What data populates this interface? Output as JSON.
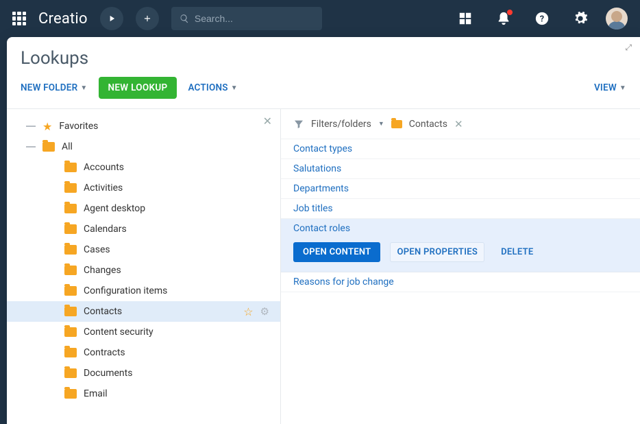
{
  "header": {
    "logo": "Creatio",
    "search_placeholder": "Search..."
  },
  "page": {
    "title": "Lookups"
  },
  "toolbar": {
    "new_folder": "NEW FOLDER",
    "new_lookup": "NEW LOOKUP",
    "actions": "ACTIONS",
    "view": "VIEW"
  },
  "sidebar": {
    "favorites": "Favorites",
    "all": "All",
    "folders": [
      "Accounts",
      "Activities",
      "Agent desktop",
      "Calendars",
      "Cases",
      "Changes",
      "Configuration items",
      "Contacts",
      "Content security",
      "Contracts",
      "Documents",
      "Email"
    ],
    "selected": "Contacts"
  },
  "filter": {
    "label": "Filters/folders",
    "active_folder": "Contacts"
  },
  "lookups": [
    "Contact types",
    "Salutations",
    "Departments",
    "Job titles",
    "Contact roles",
    "Reasons for job change"
  ],
  "active_lookup": "Contact roles",
  "row_actions": {
    "open_content": "OPEN CONTENT",
    "open_properties": "OPEN PROPERTIES",
    "delete": "DELETE"
  }
}
